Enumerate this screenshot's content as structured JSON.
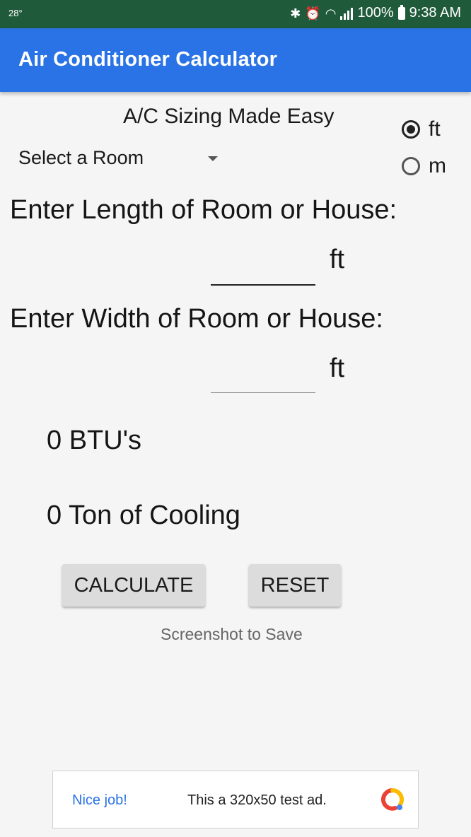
{
  "status_bar": {
    "temperature": "28°",
    "battery": "100%",
    "time": "9:38 AM"
  },
  "app_bar": {
    "title": "Air Conditioner Calculator"
  },
  "main": {
    "subtitle": "A/C Sizing Made Easy",
    "room_select": {
      "selected": "Select a Room"
    },
    "unit_options": [
      {
        "label": "ft",
        "checked": true
      },
      {
        "label": "m",
        "checked": false
      }
    ],
    "length_prompt": "Enter Length of Room or House:",
    "length_value": "",
    "length_unit": "ft",
    "width_prompt": "Enter Width of Room or House:",
    "width_value": "",
    "width_unit": "ft",
    "btu_result": "0 BTU's",
    "ton_result": "0 Ton of Cooling",
    "calculate_label": "CALCULATE",
    "reset_label": "RESET",
    "hint": "Screenshot to Save"
  },
  "ad": {
    "nice": "Nice job!",
    "text": "This a 320x50 test ad."
  }
}
